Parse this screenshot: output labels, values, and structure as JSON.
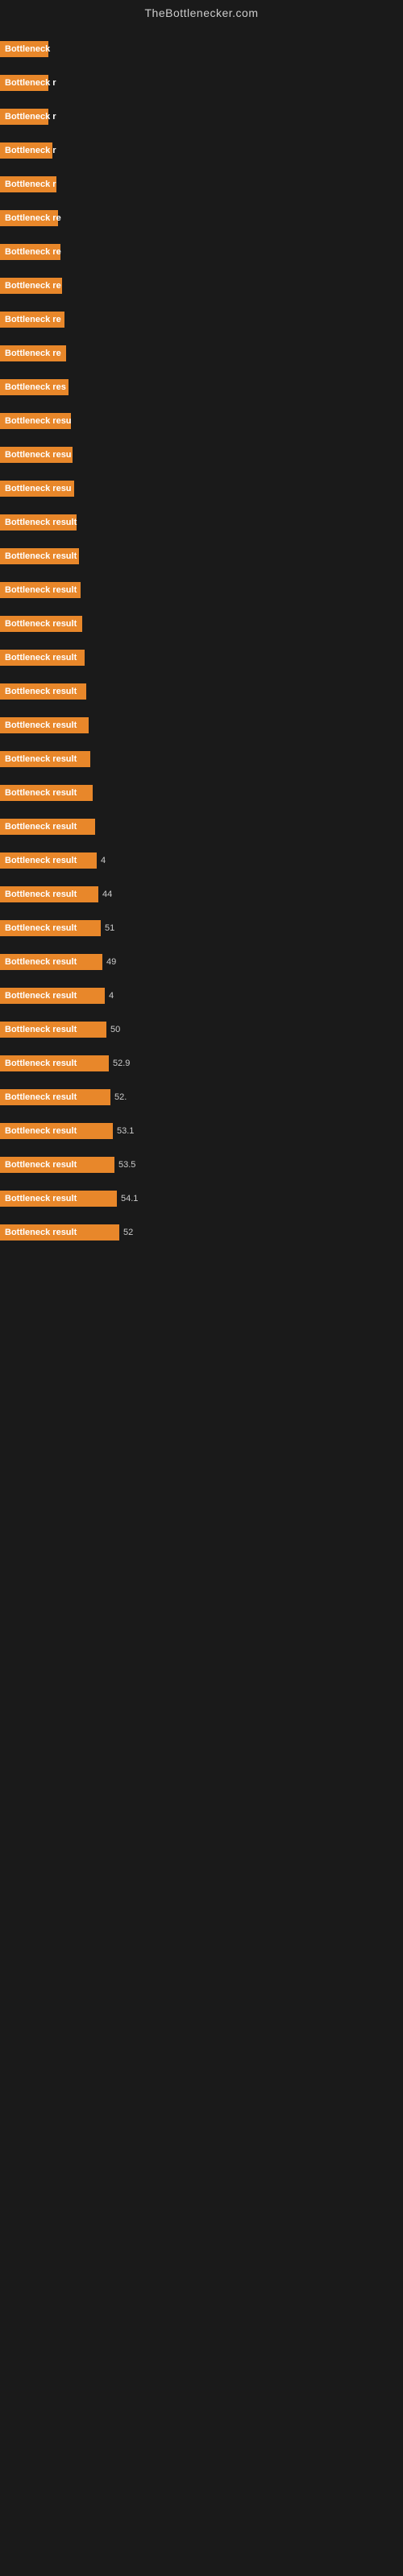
{
  "site": {
    "title": "TheBottlenecker.com"
  },
  "bars": [
    {
      "label": "Bottleneck",
      "width": 45,
      "value": ""
    },
    {
      "label": "Bottleneck r",
      "width": 55,
      "value": ""
    },
    {
      "label": "Bottleneck r",
      "width": 60,
      "value": ""
    },
    {
      "label": "Bottleneck r",
      "width": 65,
      "value": ""
    },
    {
      "label": "Bottleneck r",
      "width": 70,
      "value": ""
    },
    {
      "label": "Bottleneck re",
      "width": 72,
      "value": ""
    },
    {
      "label": "Bottleneck re",
      "width": 75,
      "value": ""
    },
    {
      "label": "Bottleneck re",
      "width": 77,
      "value": ""
    },
    {
      "label": "Bottleneck re",
      "width": 80,
      "value": ""
    },
    {
      "label": "Bottleneck re",
      "width": 82,
      "value": ""
    },
    {
      "label": "Bottleneck res",
      "width": 85,
      "value": ""
    },
    {
      "label": "Bottleneck resu",
      "width": 88,
      "value": ""
    },
    {
      "label": "Bottleneck resu",
      "width": 90,
      "value": ""
    },
    {
      "label": "Bottleneck resu",
      "width": 92,
      "value": ""
    },
    {
      "label": "Bottleneck result",
      "width": 95,
      "value": ""
    },
    {
      "label": "Bottleneck result",
      "width": 98,
      "value": ""
    },
    {
      "label": "Bottleneck result",
      "width": 100,
      "value": ""
    },
    {
      "label": "Bottleneck result",
      "width": 102,
      "value": ""
    },
    {
      "label": "Bottleneck result",
      "width": 105,
      "value": ""
    },
    {
      "label": "Bottleneck result",
      "width": 107,
      "value": ""
    },
    {
      "label": "Bottleneck result",
      "width": 110,
      "value": ""
    },
    {
      "label": "Bottleneck result",
      "width": 112,
      "value": ""
    },
    {
      "label": "Bottleneck result",
      "width": 115,
      "value": ""
    },
    {
      "label": "Bottleneck result",
      "width": 118,
      "value": ""
    },
    {
      "label": "Bottleneck result",
      "width": 120,
      "value": "4"
    },
    {
      "label": "Bottleneck result",
      "width": 122,
      "value": "44"
    },
    {
      "label": "Bottleneck result",
      "width": 125,
      "value": "51"
    },
    {
      "label": "Bottleneck result",
      "width": 127,
      "value": "49"
    },
    {
      "label": "Bottleneck result",
      "width": 130,
      "value": "4"
    },
    {
      "label": "Bottleneck result",
      "width": 132,
      "value": "50"
    },
    {
      "label": "Bottleneck result",
      "width": 135,
      "value": "52.9"
    },
    {
      "label": "Bottleneck result",
      "width": 137,
      "value": "52."
    },
    {
      "label": "Bottleneck result",
      "width": 140,
      "value": "53.1"
    },
    {
      "label": "Bottleneck result",
      "width": 142,
      "value": "53.5"
    },
    {
      "label": "Bottleneck result",
      "width": 145,
      "value": "54.1"
    },
    {
      "label": "Bottleneck result",
      "width": 148,
      "value": "52"
    }
  ]
}
